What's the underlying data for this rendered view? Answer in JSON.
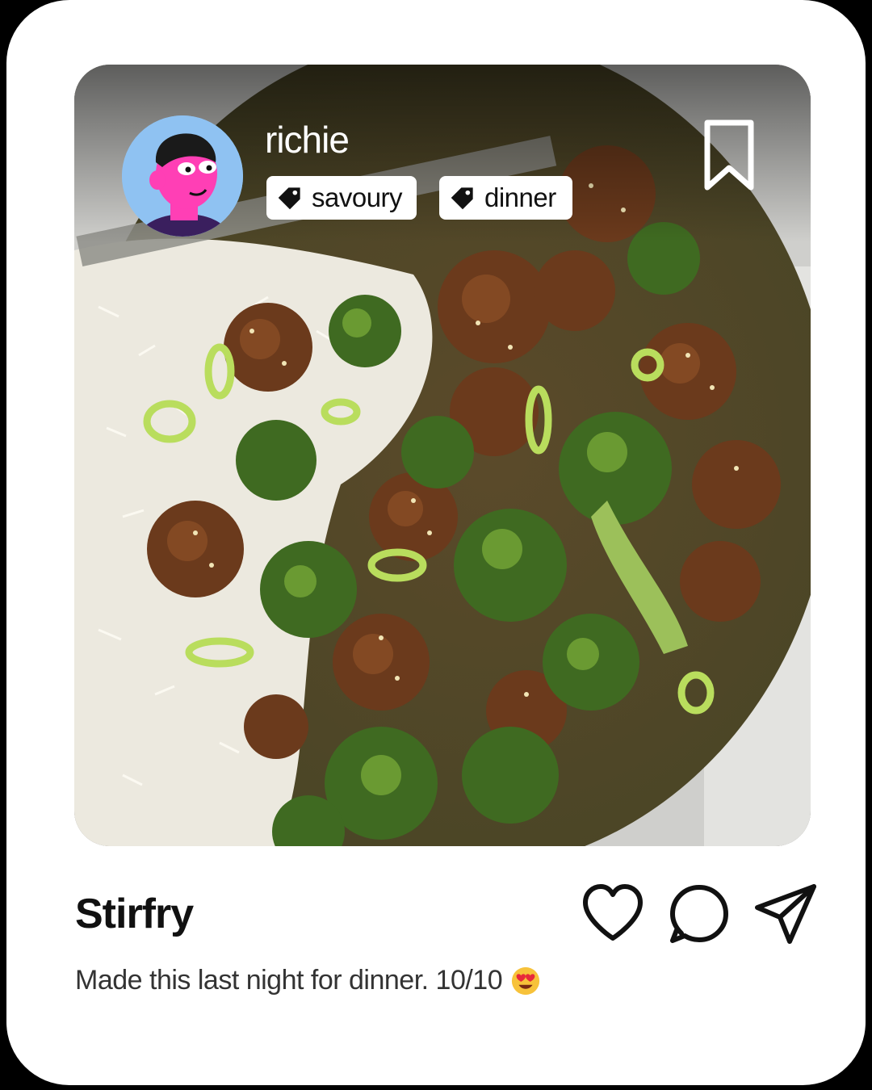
{
  "post": {
    "username": "richie",
    "tags": [
      {
        "label": "savoury",
        "icon": "tag-icon"
      },
      {
        "label": "dinner",
        "icon": "tag-icon"
      }
    ],
    "title": "Stirfry",
    "caption": "Made this last night for dinner. 10/10",
    "caption_emoji": "heart-eyes-emoji"
  },
  "actions": {
    "like_icon": "heart-icon",
    "comment_icon": "comment-icon",
    "share_icon": "send-icon",
    "bookmark_icon": "bookmark-icon"
  },
  "colors": {
    "card_background": "#ffffff",
    "outer_background": "#000000",
    "avatar_background": "#8fc2f2",
    "avatar_skin": "#ff3fb5"
  }
}
